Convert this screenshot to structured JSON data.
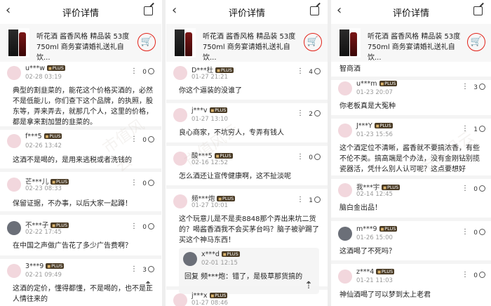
{
  "header": {
    "title": "评价详情",
    "back_icon": "‹",
    "share_icon": "share"
  },
  "product": {
    "title": "听花酒 酱香风格 精品装 53度 750ml 商务宴请婚礼送礼自饮..."
  },
  "watermark": "市值风云",
  "panel1": {
    "comments": [
      {
        "user": "u***w",
        "plus": "PLUS",
        "date": "02-28 03:19",
        "likes": "0",
        "text": "典型的割韭菜的，能花这个价格买酒的，必然不是低能儿，你们查下这个品牌，的执照，股东等，弄来弄去，就那几个人，这里的价格，都是拿来割加盟的韭菜的。"
      },
      {
        "user": "f***5",
        "plus": "PLUS",
        "date": "02-26 13:42",
        "likes": "0",
        "text": "这酒不是喝的，是用来逃税或者洗钱的"
      },
      {
        "user": "芒***儿",
        "plus": "PLUS",
        "date": "02-23 08:33",
        "likes": "0",
        "text": "保留证据，不办事，以后大家一起蹲！"
      },
      {
        "user": "不***子",
        "plus": "PLUS",
        "date": "02-22 17:45",
        "likes": "0",
        "text": "在中国之声做广告花了多少广告费啊？"
      },
      {
        "user": "3***9",
        "plus": "PLUS",
        "date": "02-21 09:49",
        "likes": "3",
        "text": "这酒的定价，懂得都懂，不是喝的，也不是正人情往来的"
      }
    ]
  },
  "panel2": {
    "comments": [
      {
        "user": "D***杜",
        "plus": "PLUS",
        "date": "01-27 21:21",
        "likes": "4",
        "text": "你这个逼装的没谁了"
      },
      {
        "user": "j***v",
        "plus": "PLUS",
        "date": "01-27 13:10",
        "likes": "2",
        "text": "良心商家，不坑穷人，专弄有钱人"
      },
      {
        "user": "酸***5",
        "plus": "PLUS",
        "date": "02-16 12:52",
        "likes": "0",
        "text": "怎么酒还让宣传健康啊，这不扯淡呢"
      },
      {
        "user": "频***炮",
        "plus": "PLUS",
        "date": "01-27 10:01",
        "likes": "1",
        "text": "这个玩意儿是不是卖8848那个弄出来坑二货的？喝酱香酒我不会买茅台吗？脑子被驴踢了买这个神马东西！"
      },
      {
        "user": "j***x",
        "plus": "PLUS",
        "date": "01-27 08:46",
        "likes": "",
        "text": ""
      }
    ],
    "reply": {
      "user": "x***d",
      "plus": "PLUS",
      "date": "02-01 12:15",
      "text": "回复 频***炮：错了，是极草那货搞的"
    }
  },
  "panel3": {
    "top_text": "智商酒",
    "comments": [
      {
        "user": "u***m",
        "plus": "PLUS",
        "date": "01-23 20:07",
        "likes": "3",
        "text": "你老板真是大冤种"
      },
      {
        "user": "J***Y",
        "plus": "PLUS",
        "date": "01-23 15:56",
        "likes": "1",
        "text": "这个酒定位不清晰，酱香就不要搞浓香，有些不伦不类。搞高端是个办法，没有金刚钻别揽瓷器活，凭什么别人认可呢？这点要想好"
      },
      {
        "user": "我***宇",
        "plus": "PLUS",
        "date": "02-14 12:45",
        "likes": "0",
        "text": "脑白金出品！"
      },
      {
        "user": "m***9",
        "plus": "PLUS",
        "date": "01-26 15:00",
        "likes": "0",
        "text": "这酒喝了不死吗？"
      },
      {
        "user": "z***4",
        "plus": "PLUS",
        "date": "01-21 11:03",
        "likes": "0",
        "text": "神仙酒喝了可以梦到太上老君"
      }
    ]
  },
  "totop_icon": "⇡"
}
